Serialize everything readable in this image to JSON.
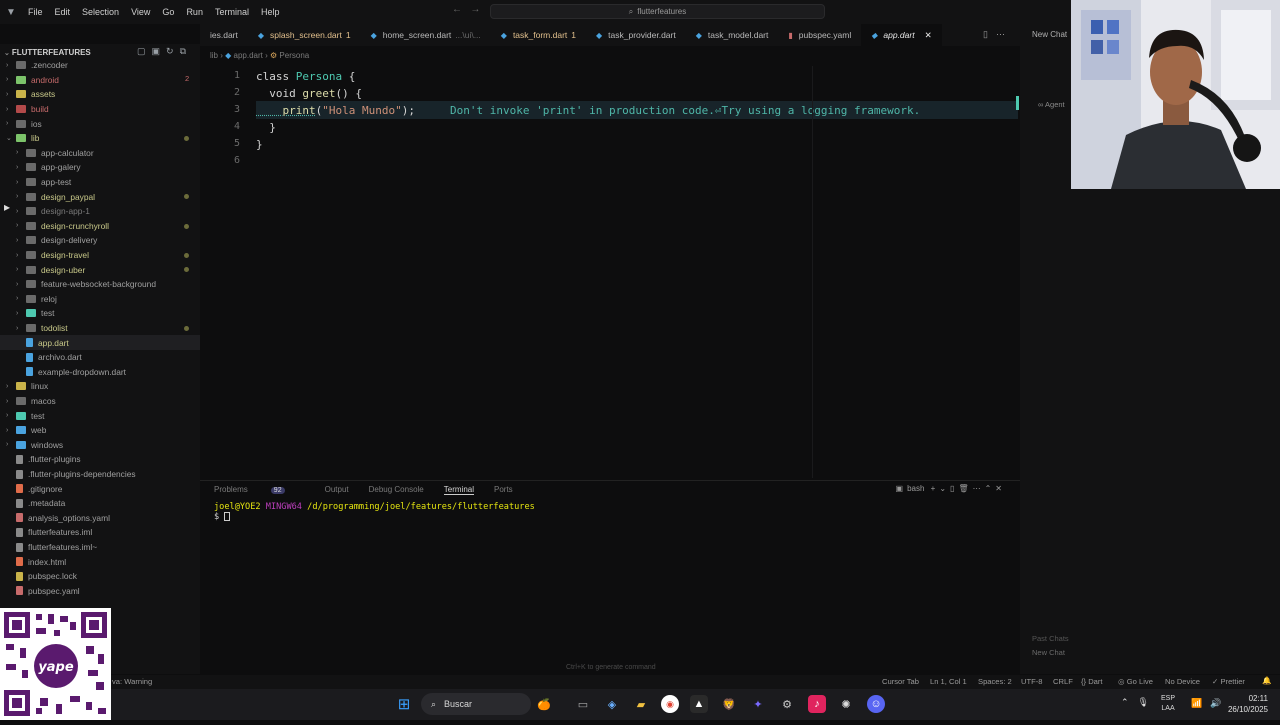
{
  "titlebar": {
    "menu": [
      "File",
      "Edit",
      "Selection",
      "View",
      "Go",
      "Run",
      "Terminal",
      "Help"
    ],
    "search": "flutterfeatures"
  },
  "sidebar": {
    "header": "FLUTTERFEATURES",
    "items": [
      {
        "label": ".zencoder",
        "type": "folder",
        "color": "#a0a0a0",
        "icon": "#6a6a6a"
      },
      {
        "label": "android",
        "type": "folder",
        "color": "#c76b6b",
        "icon": "#7cc36a",
        "count": "2"
      },
      {
        "label": "assets",
        "type": "folder",
        "color": "#c9c98a",
        "icon": "#c9b34a"
      },
      {
        "label": "build",
        "type": "folder",
        "color": "#c76b6b",
        "icon": "#b34a4a"
      },
      {
        "label": "ios",
        "type": "folder",
        "color": "#a0a0a0",
        "icon": "#6a6a6a"
      },
      {
        "label": "lib",
        "type": "folder-open",
        "color": "#c9c98a",
        "icon": "#7cc36a",
        "dot": true
      },
      {
        "label": "app-calculator",
        "type": "sub",
        "color": "#a0a0a0",
        "icon": "#6a6a6a"
      },
      {
        "label": "app-galery",
        "type": "sub",
        "color": "#a0a0a0",
        "icon": "#6a6a6a"
      },
      {
        "label": "app-test",
        "type": "sub",
        "color": "#a0a0a0",
        "icon": "#6a6a6a"
      },
      {
        "label": "design_paypal",
        "type": "sub",
        "color": "#c9c98a",
        "icon": "#6a6a6a",
        "dot": true
      },
      {
        "label": "design-app-1",
        "type": "sub",
        "color": "#7a7a7a",
        "icon": "#6a6a6a"
      },
      {
        "label": "design-crunchyroll",
        "type": "sub",
        "color": "#c9c98a",
        "icon": "#6a6a6a",
        "dot": true
      },
      {
        "label": "design-delivery",
        "type": "sub",
        "color": "#a0a0a0",
        "icon": "#6a6a6a"
      },
      {
        "label": "design-travel",
        "type": "sub",
        "color": "#c9c98a",
        "icon": "#6a6a6a",
        "dot": true
      },
      {
        "label": "design-uber",
        "type": "sub",
        "color": "#c9c98a",
        "icon": "#6a6a6a",
        "dot": true
      },
      {
        "label": "feature-websocket-background",
        "type": "sub",
        "color": "#a0a0a0",
        "icon": "#6a6a6a"
      },
      {
        "label": "reloj",
        "type": "sub",
        "color": "#a0a0a0",
        "icon": "#6a6a6a"
      },
      {
        "label": "test",
        "type": "sub",
        "color": "#a0a0a0",
        "icon": "#4ec9b0"
      },
      {
        "label": "todolist",
        "type": "sub",
        "color": "#c9c98a",
        "icon": "#6a6a6a",
        "dot": true
      },
      {
        "label": "app.dart",
        "type": "subfile",
        "color": "#c9c98a",
        "icon": "#4aa3df",
        "selected": true
      },
      {
        "label": "archivo.dart",
        "type": "subfile",
        "color": "#a0a0a0",
        "icon": "#4aa3df"
      },
      {
        "label": "example-dropdown.dart",
        "type": "subfile",
        "color": "#a0a0a0",
        "icon": "#4aa3df"
      },
      {
        "label": "linux",
        "type": "folder",
        "color": "#a0a0a0",
        "icon": "#c9b34a"
      },
      {
        "label": "macos",
        "type": "folder",
        "color": "#a0a0a0",
        "icon": "#6a6a6a"
      },
      {
        "label": "test",
        "type": "folder",
        "color": "#a0a0a0",
        "icon": "#4ec9b0"
      },
      {
        "label": "web",
        "type": "folder",
        "color": "#a0a0a0",
        "icon": "#4aa3df"
      },
      {
        "label": "windows",
        "type": "folder",
        "color": "#a0a0a0",
        "icon": "#4aa3df"
      },
      {
        "label": ".flutter-plugins",
        "type": "file",
        "color": "#a0a0a0",
        "icon": "#8a8a8a"
      },
      {
        "label": ".flutter-plugins-dependencies",
        "type": "file",
        "color": "#a0a0a0",
        "icon": "#8a8a8a"
      },
      {
        "label": ".gitignore",
        "type": "file",
        "color": "#a0a0a0",
        "icon": "#e06c4a"
      },
      {
        "label": ".metadata",
        "type": "file",
        "color": "#a0a0a0",
        "icon": "#8a8a8a"
      },
      {
        "label": "analysis_options.yaml",
        "type": "file",
        "color": "#a0a0a0",
        "icon": "#c76b6b"
      },
      {
        "label": "flutterfeatures.iml",
        "type": "file",
        "color": "#a0a0a0",
        "icon": "#8a8a8a"
      },
      {
        "label": "flutterfeatures.iml~",
        "type": "file",
        "color": "#a0a0a0",
        "icon": "#8a8a8a"
      },
      {
        "label": "index.html",
        "type": "file",
        "color": "#a0a0a0",
        "icon": "#e06c4a"
      },
      {
        "label": "pubspec.lock",
        "type": "file",
        "color": "#a0a0a0",
        "icon": "#c9b34a"
      },
      {
        "label": "pubspec.yaml",
        "type": "file",
        "color": "#a0a0a0",
        "icon": "#c76b6b"
      }
    ]
  },
  "tabs": [
    {
      "label": "ies.dart",
      "active": false
    },
    {
      "label": "splash_screen.dart",
      "badge": "1",
      "active": false
    },
    {
      "label": "home_screen.dart",
      "suffix": "...\\ui\\...",
      "active": false
    },
    {
      "label": "task_form.dart",
      "badge": "1",
      "active": false
    },
    {
      "label": "task_provider.dart",
      "active": false
    },
    {
      "label": "task_model.dart",
      "active": false
    },
    {
      "label": "pubspec.yaml",
      "active": false
    },
    {
      "label": "app.dart",
      "active": true
    }
  ],
  "breadcrumb": {
    "folder": "lib",
    "file": "app.dart",
    "symbol": "Persona"
  },
  "editor": {
    "lines": [
      "1",
      "2",
      "3",
      "4",
      "5",
      "6"
    ],
    "line1": {
      "kw": "class ",
      "cls": "Persona",
      "rest": " {"
    },
    "line2": {
      "kw": "  void ",
      "fn": "greet",
      "rest": "() {"
    },
    "line3": {
      "fn": "    print",
      "p1": "(",
      "str": "\"Hola Mundo\"",
      "p2": ");"
    },
    "line4": "  }",
    "line5": "}",
    "hint": "Don't invoke 'print' in production code.⏎Try using a logging framework."
  },
  "panel": {
    "tabs": {
      "problems": "Problems",
      "problems_count": "92",
      "output": "Output",
      "debug": "Debug Console",
      "terminal": "Terminal",
      "ports": "Ports"
    },
    "shell": "bash",
    "prompt_user": "joel@YOE2",
    "prompt_env": "MINGW64",
    "prompt_path": "/d/programming/joel/features/flutterfeatures",
    "prompt_symbol": "$"
  },
  "rightpane": {
    "new_chat": "New Chat",
    "agent": "Agent",
    "past_chats": "Past Chats",
    "new_chat_bottom": "New Chat"
  },
  "statusbar": {
    "left": "va: Warning",
    "center": "Ctrl+K to generate command",
    "cursor_tab": "Cursor Tab",
    "position": "Ln 1, Col 1",
    "spaces": "Spaces: 2",
    "encoding": "UTF-8",
    "eol": "CRLF",
    "language": "Dart",
    "golive": "Go Live",
    "device": "No Device",
    "prettier": "Prettier"
  },
  "taskbar": {
    "search": "Buscar",
    "lang1": "ESP",
    "lang2": "LAA",
    "time": "02:11",
    "date": "26/10/2025"
  }
}
